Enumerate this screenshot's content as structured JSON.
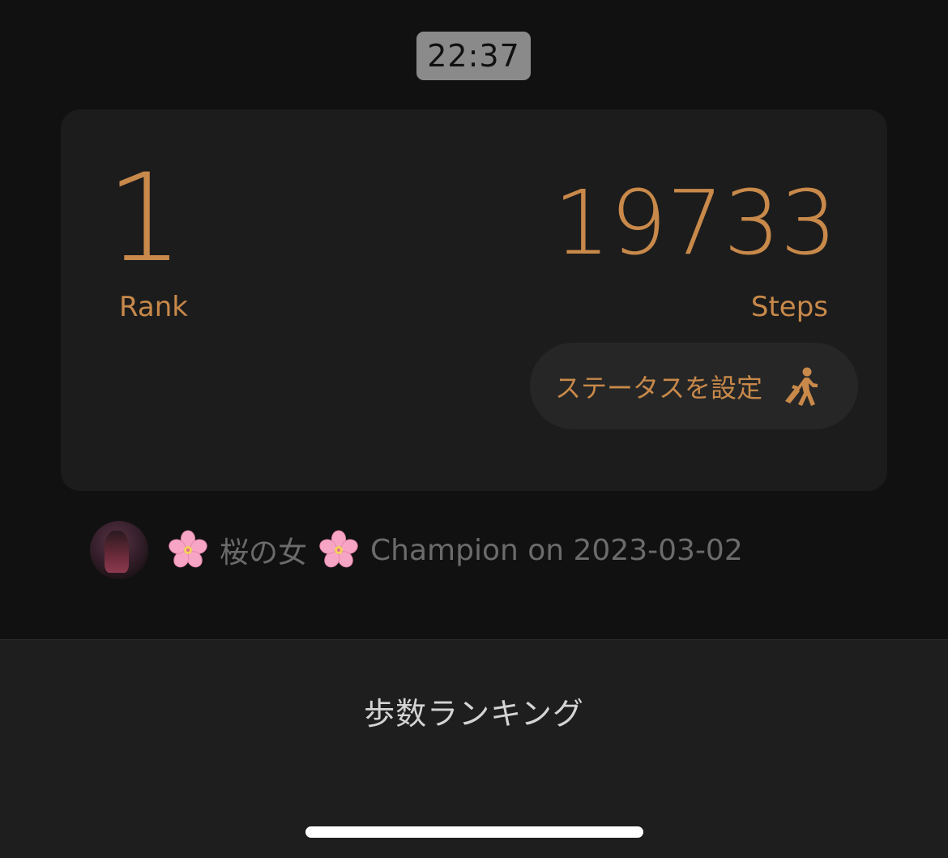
{
  "status_bar": {
    "time": "22:37"
  },
  "colors": {
    "accent": "#c8894a",
    "background": "#111111",
    "card": "#1c1c1c",
    "muted_text": "#6b6b6b"
  },
  "card": {
    "rank_value": "1",
    "rank_label": "Rank",
    "steps_value": "19733",
    "steps_label": "Steps",
    "status_button_label": "ステータスを設定",
    "status_button_icon": "walking-person-icon"
  },
  "champion": {
    "avatar_icon": "user-avatar",
    "name_prefix_icon": "cherry-blossom-icon",
    "name": "桜の女",
    "name_suffix_icon": "cherry-blossom-icon",
    "caption": "Champion on 2023-03-02"
  },
  "bottom_bar": {
    "title": "歩数ランキング"
  }
}
